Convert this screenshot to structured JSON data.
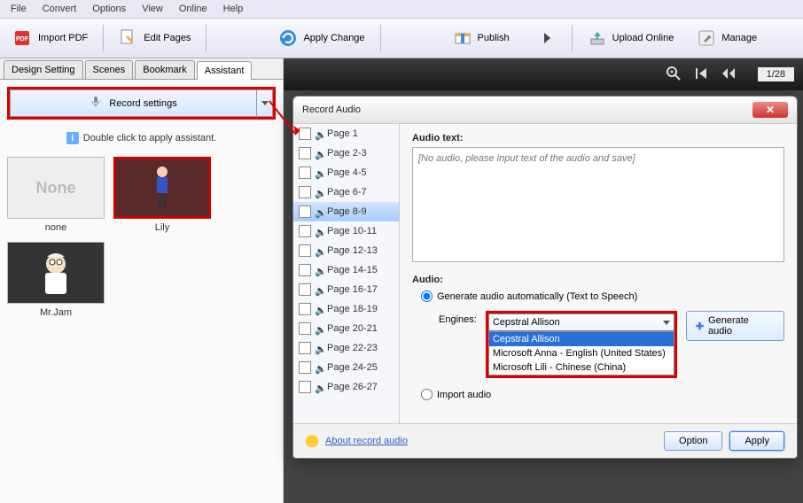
{
  "menu": {
    "items": [
      "File",
      "Convert",
      "Options",
      "View",
      "Online",
      "Help"
    ]
  },
  "toolbar": {
    "import_pdf": "Import PDF",
    "edit_pages": "Edit Pages",
    "apply_change": "Apply Change",
    "publish": "Publish",
    "upload_online": "Upload Online",
    "manage": "Manage"
  },
  "left": {
    "tabs": [
      "Design Setting",
      "Scenes",
      "Bookmark",
      "Assistant"
    ],
    "active_tab": 3,
    "record_settings": "Record settings",
    "hint": "Double click to apply assistant.",
    "thumbs": [
      {
        "label": "none",
        "caption": "None",
        "selected": false
      },
      {
        "label": "Lily",
        "caption": "",
        "selected": true
      },
      {
        "label": "Mr.Jam",
        "caption": "",
        "selected": false
      }
    ]
  },
  "viewer": {
    "page_indicator": "1/28"
  },
  "dialog": {
    "title": "Record Audio",
    "pages": [
      "Page 1",
      "Page 2-3",
      "Page 4-5",
      "Page 6-7",
      "Page 8-9",
      "Page 10-11",
      "Page 12-13",
      "Page 14-15",
      "Page 16-17",
      "Page 18-19",
      "Page 20-21",
      "Page 22-23",
      "Page 24-25",
      "Page 26-27"
    ],
    "selected_page": 4,
    "audio_text_label": "Audio text:",
    "audio_text_placeholder": "[No audio, please input text of the audio and save]",
    "audio_label": "Audio:",
    "radio_generate": "Generate audio automatically (Text to Speech)",
    "radio_import": "Import audio",
    "engines_label": "Engines:",
    "engine_selected": "Cepstral Allison",
    "engine_options": [
      "Cepstral Allison",
      "Microsoft Anna - English (United States)",
      "Microsoft Lili - Chinese (China)"
    ],
    "generate_btn": "Generate audio",
    "about_link": "About record audio",
    "option_btn": "Option",
    "apply_btn": "Apply"
  }
}
